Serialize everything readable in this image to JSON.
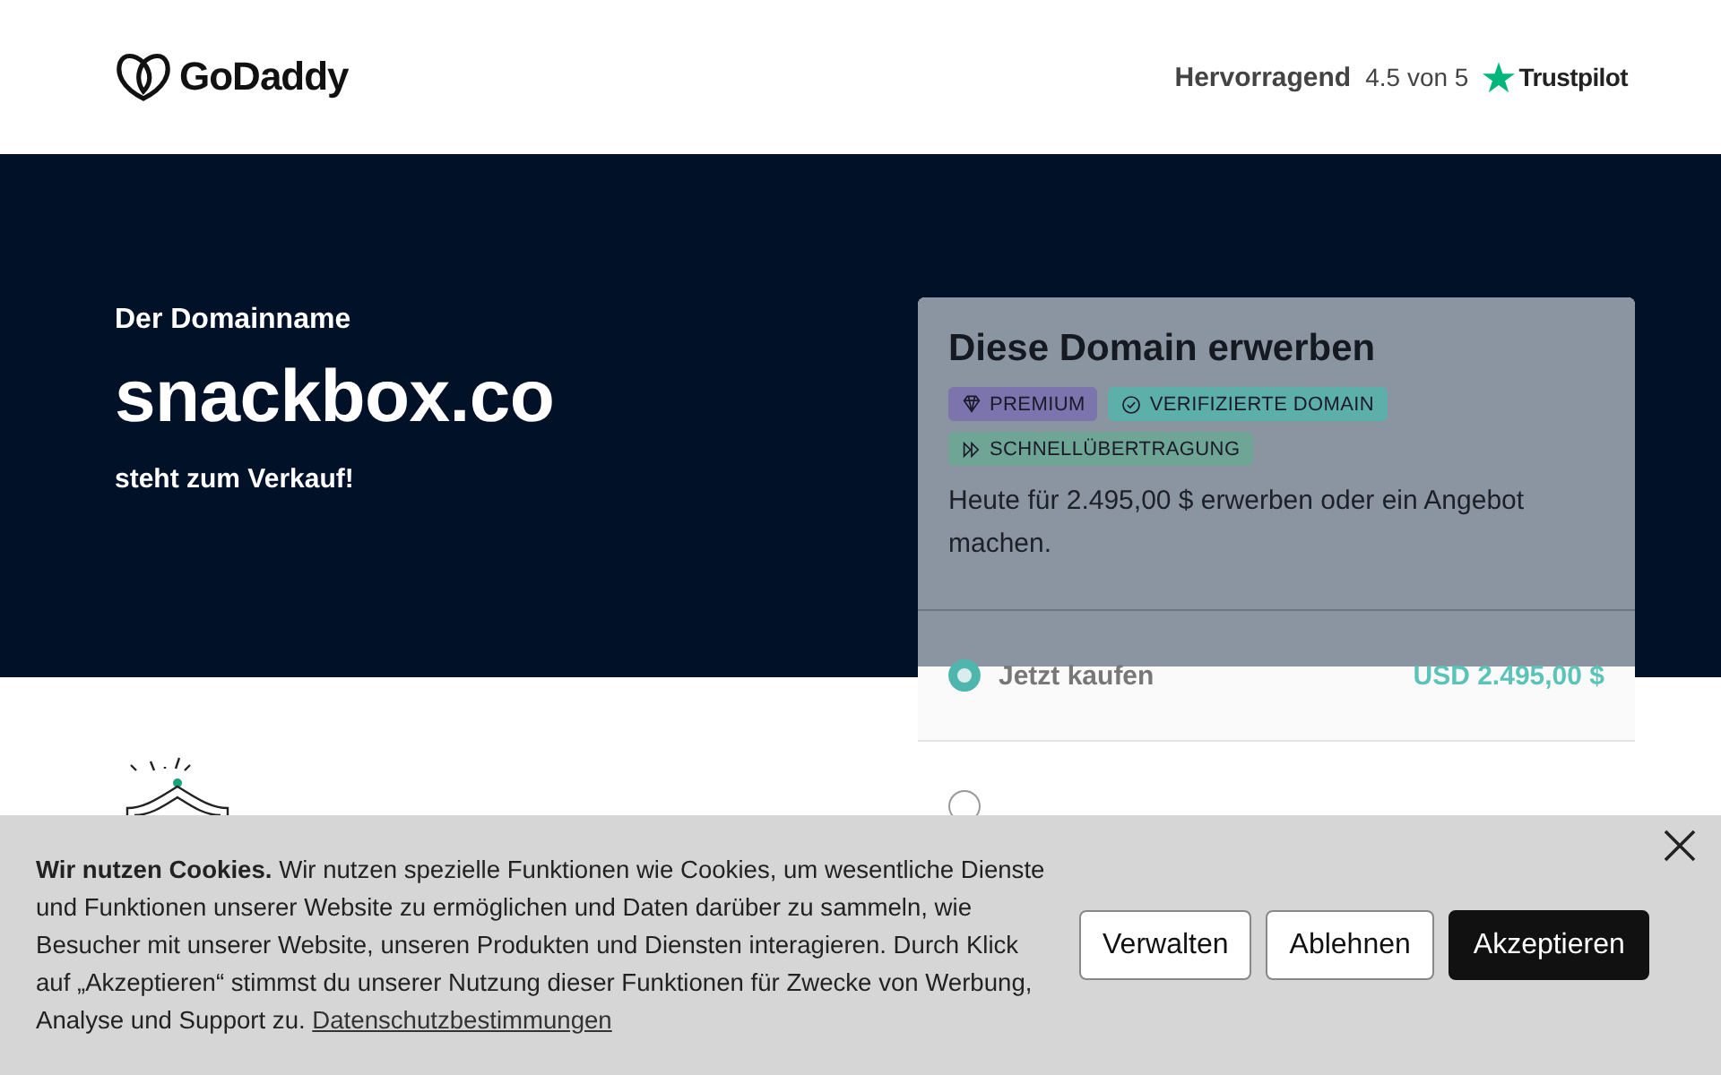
{
  "header": {
    "brand": "GoDaddy",
    "rating_label": "Hervorragend",
    "rating": "4.5 von 5",
    "trustpilot": "Trustpilot"
  },
  "hero": {
    "eyebrow": "Der Domainname",
    "domain": "snackbox.co",
    "subtitle": "steht zum Verkauf!"
  },
  "card": {
    "title": "Diese Domain erwerben",
    "badges": [
      {
        "kind": "premium",
        "label": "PREMIUM"
      },
      {
        "kind": "verified",
        "label": "VERIFIZIERTE DOMAIN"
      },
      {
        "kind": "fast",
        "label": "SCHNELLÜBERTRAGUNG"
      }
    ],
    "description": "Heute für 2.495,00 $ erwerben oder ein Angebot machen.",
    "options": [
      {
        "label": "Jetzt kaufen",
        "price": "USD 2.495,00 $",
        "selected": true
      },
      {
        "selected": false
      }
    ]
  },
  "cookie_banner": {
    "text": "**Wir nutzen Cookies.** Wir nutzen spezielle Funktionen wie Cookies, um wesentliche Dienste und Funktionen unserer Website zu ermöglichen und Daten darüber zu sammeln, wie Besucher mit unserer Website, unseren Produkten und Diensten interagieren. Durch Klick auf „Akzeptieren“ stimmst du unserer Nutzung dieser Funktionen für Zwecke von Werbung, Analyse und Support zu.",
    "link": "Datenschutzbestimmungen",
    "buttons": [
      {
        "kind": "secondary",
        "label": "Verwalten"
      },
      {
        "kind": "secondary",
        "label": "Ablehnen"
      },
      {
        "kind": "primary",
        "label": "Akzeptieren"
      }
    ]
  }
}
